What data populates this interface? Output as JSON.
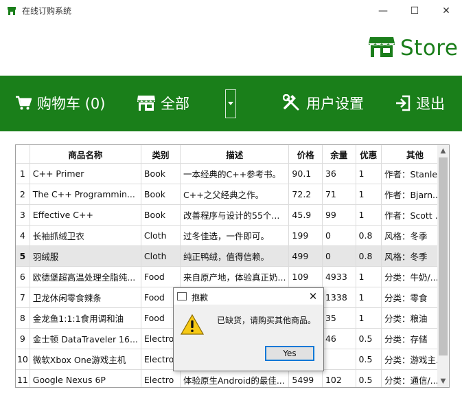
{
  "window": {
    "title": "在线订购系统",
    "minimize": "—",
    "maximize": "☐",
    "close": "✕"
  },
  "brand": {
    "text": "Store"
  },
  "nav": {
    "cart_label": "购物车 (0)",
    "all_label": "全部",
    "settings_label": "用户设置",
    "exit_label": "退出"
  },
  "table": {
    "columns": [
      "商品名称",
      "类别",
      "描述",
      "价格",
      "余量",
      "优惠",
      "其他"
    ],
    "rows": [
      {
        "n": "1",
        "name": "C++ Primer",
        "cat": "Book",
        "desc": "一本经典的C++参考书。",
        "price": "90.1",
        "stock": "36",
        "disc": "1",
        "other": "作者：Stanle..."
      },
      {
        "n": "2",
        "name": "The C++ Programmin...",
        "cat": "Book",
        "desc": "C++之父经典之作。",
        "price": "72.2",
        "stock": "71",
        "disc": "1",
        "other": "作者：Bjarn..."
      },
      {
        "n": "3",
        "name": "Effective C++",
        "cat": "Book",
        "desc": "改善程序与设计的55个...",
        "price": "45.9",
        "stock": "99",
        "disc": "1",
        "other": "作者：Scott ..."
      },
      {
        "n": "4",
        "name": "长袖抓绒卫衣",
        "cat": "Cloth",
        "desc": "过冬佳选，一件即可。",
        "price": "199",
        "stock": "0",
        "disc": "0.8",
        "other": "风格：冬季"
      },
      {
        "n": "5",
        "name": "羽绒服",
        "cat": "Cloth",
        "desc": "纯正鸭绒，值得信赖。",
        "price": "499",
        "stock": "0",
        "disc": "0.8",
        "other": "风格：冬季"
      },
      {
        "n": "6",
        "name": "欧德堡超高温处理全脂纯...",
        "cat": "Food",
        "desc": "来自原产地，体验真正奶...",
        "price": "109",
        "stock": "4933",
        "disc": "1",
        "other": "分类：牛奶/..."
      },
      {
        "n": "7",
        "name": "卫龙休闲零食辣条",
        "cat": "Food",
        "desc": "",
        "price": "",
        "stock": "1338",
        "disc": "1",
        "other": "分类：零食"
      },
      {
        "n": "8",
        "name": "金龙鱼1:1:1食用调和油",
        "cat": "Food",
        "desc": "",
        "price": "",
        "stock": "35",
        "disc": "1",
        "other": "分类：粮油"
      },
      {
        "n": "9",
        "name": "金士顿 DataTraveler 16...",
        "cat": "Electro",
        "desc": "",
        "price": "",
        "stock": "46",
        "disc": "0.5",
        "other": "分类：存储"
      },
      {
        "n": "10",
        "name": "微软Xbox One游戏主机",
        "cat": "Electro",
        "desc": "",
        "price": "",
        "stock": "",
        "disc": "0.5",
        "other": "分类：游戏主..."
      },
      {
        "n": "11",
        "name": "Google Nexus 6P",
        "cat": "Electro",
        "desc": "体验原生Android的最佳...",
        "price": "5499",
        "stock": "102",
        "disc": "0.5",
        "other": "分类：通信/..."
      }
    ]
  },
  "dialog": {
    "title": "抱歉",
    "message": "已缺货，请购买其他商品。",
    "yes_label": "Yes",
    "close": "✕"
  },
  "colors": {
    "accent": "#1a7f1a",
    "brand": "#1b7e1b"
  }
}
